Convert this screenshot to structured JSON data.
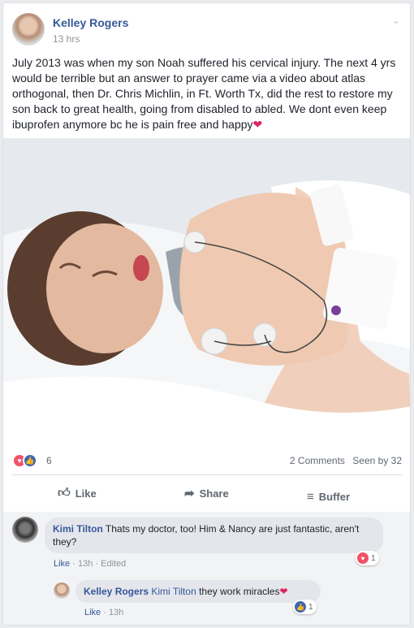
{
  "post": {
    "author": "Kelley Rogers",
    "time": "13 hrs",
    "text": "July 2013 was when my son Noah suffered his cervical injury. The next 4 yrs would be terrible but an answer to prayer came via a video about atlas orthogonal, then Dr. Chris Michlin, in Ft. Worth Tx, did the rest to restore my son back to great health, going from disabled to abled. We dont even keep ibuprofen anymore bc he is pain free and happy",
    "emoji": "❤"
  },
  "stats": {
    "reaction_count": "6",
    "comments": "2 Comments",
    "seen_by": "Seen by 32"
  },
  "actions": {
    "like": "Like",
    "share": "Share",
    "buffer": "Buffer"
  },
  "comments": [
    {
      "author": "Kimi Tilton",
      "text": "Thats my doctor, too! Him & Nancy are just fantastic, aren't they?",
      "like": "Like",
      "time": "13h",
      "edited": "Edited",
      "reaction_count": "1"
    },
    {
      "author": "Kelley Rogers",
      "mention": "Kimi Tilton",
      "text": "they work miracles",
      "emoji": "❤",
      "like": "Like",
      "time": "13h",
      "reaction_count": "1"
    }
  ],
  "icons": {
    "chevron": "chevron-down-icon",
    "like": "thumbs-up-icon",
    "share": "share-arrow-icon",
    "buffer": "buffer-stack-icon",
    "love": "heart-reaction-icon",
    "like_reaction": "like-reaction-icon"
  },
  "colors": {
    "link": "#365899",
    "love": "#f25268",
    "like": "#4267b2",
    "muted": "#90949c"
  }
}
